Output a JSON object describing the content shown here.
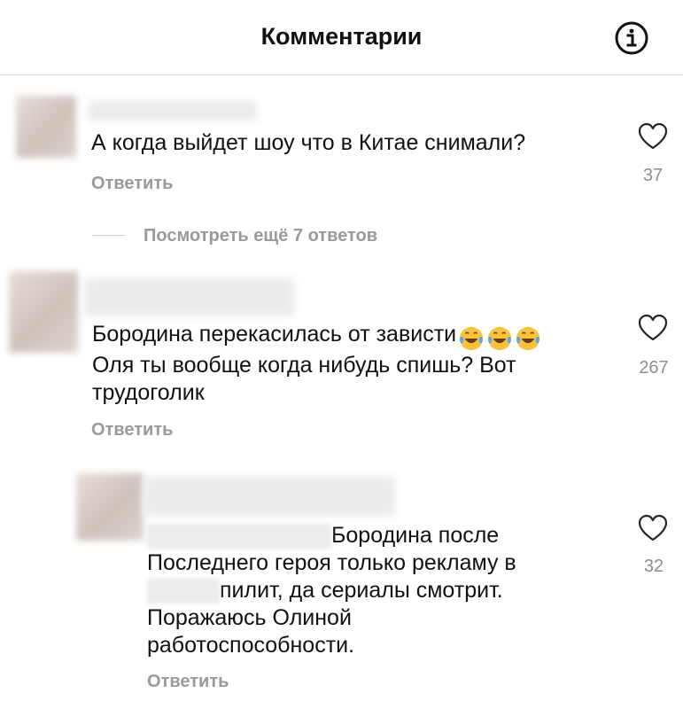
{
  "header": {
    "title": "Комментарии",
    "info_icon": "info-icon"
  },
  "comments": [
    {
      "text": "А когда выйдет шоу что в Китае снимали?",
      "reply_label": "Ответить",
      "likes": "37",
      "more_replies": "Посмотреть ещё 7 ответов"
    },
    {
      "line1": "Бородина перекасилась от зависти",
      "emoji": [
        "face-with-tears-of-joy",
        "face-with-tears-of-joy",
        "face-with-tears-of-joy"
      ],
      "line2": "Оля ты вообще когда нибудь спишь? Вот",
      "line3": "трудоголик",
      "reply_label": "Ответить",
      "likes": "267"
    },
    {
      "line1": "Бородина после",
      "line2": "Последнего героя только рекламу в",
      "line3": "пилит, да сериалы смотрит.",
      "line4": "Поражаюсь Олиной",
      "line5": "работоспособности.",
      "reply_label": "Ответить",
      "likes": "32"
    }
  ],
  "colors": {
    "secondary_text": "#9a9a9a",
    "divider": "#dcdcdc",
    "icon": "#262626"
  }
}
